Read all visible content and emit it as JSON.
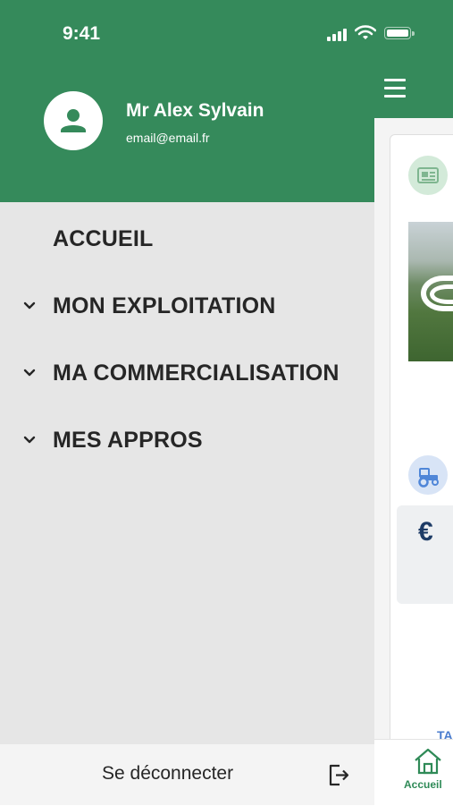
{
  "status_bar": {
    "time": "9:41"
  },
  "user": {
    "name": "Mr Alex Sylvain",
    "email": "email@email.fr"
  },
  "menu": {
    "items": [
      {
        "label": "ACCUEIL",
        "expandable": false
      },
      {
        "label": "MON EXPLOITATION",
        "expandable": true
      },
      {
        "label": "MA COMMERCIALISATION",
        "expandable": true
      },
      {
        "label": "MES APPROS",
        "expandable": true
      }
    ]
  },
  "logout": {
    "label": "Se déconnecter"
  },
  "background_screen": {
    "euro_symbol": "€",
    "peek_text": "TA",
    "tab_home_label": "Accueil"
  },
  "colors": {
    "brand_green": "#358a5b",
    "drawer_bg": "#e6e6e6",
    "text_dark": "#262626"
  },
  "icons": [
    "menu-icon",
    "user-icon",
    "newspaper-icon",
    "tractor-icon",
    "euro-icon",
    "home-icon",
    "chevron-down-icon",
    "logout-icon"
  ]
}
